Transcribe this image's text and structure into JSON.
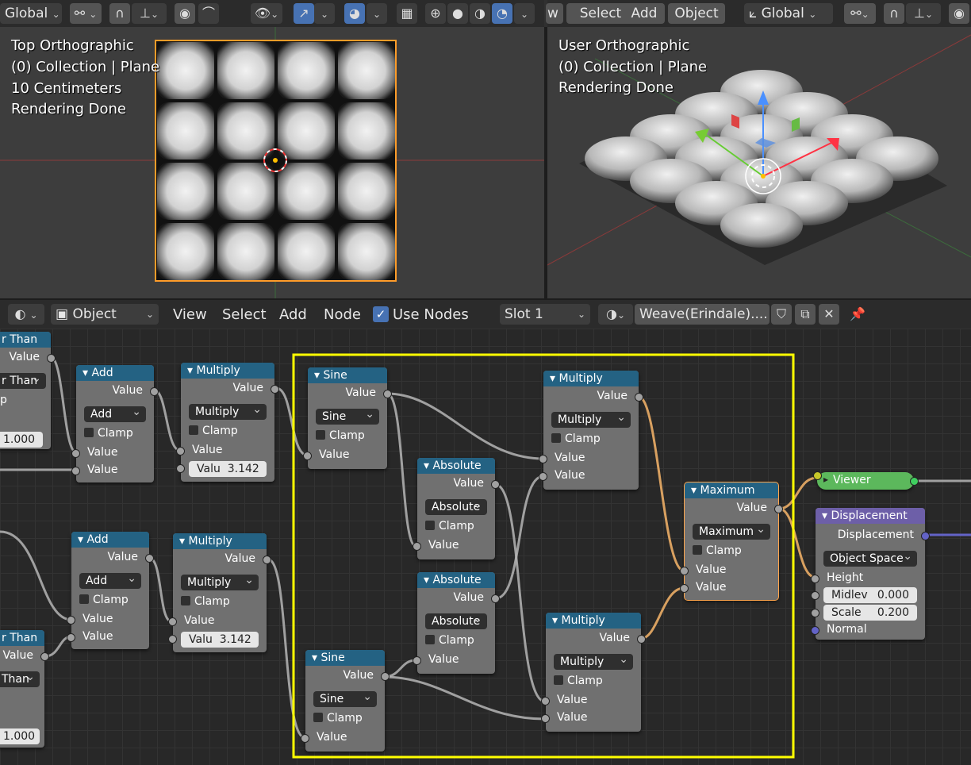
{
  "top_header": {
    "left": {
      "global_label": "Global",
      "active_mode": "Global"
    },
    "right": {
      "view_tail": "w",
      "select": "Select",
      "add": "Add",
      "object": "Object",
      "global_label": "Global"
    }
  },
  "viewport_left": {
    "line1": "Top Orthographic",
    "line2": "(0) Collection | Plane",
    "line3": "10 Centimeters",
    "line4": "Rendering Done"
  },
  "viewport_right": {
    "line1": "User Orthographic",
    "line2": "(0) Collection | Plane",
    "line3": "Rendering Done"
  },
  "node_header": {
    "mode": "Object",
    "view": "View",
    "select": "Select",
    "add": "Add",
    "node": "Node",
    "use_nodes": "Use Nodes",
    "slot": "Slot 1",
    "material": "Weave(Erindale)...."
  },
  "common": {
    "value": "Value",
    "clamp": "Clamp"
  },
  "nodes": {
    "gt1": {
      "title": "r Than",
      "value": "Value",
      "mode": "r Than",
      "p": "p",
      "field": "1.000"
    },
    "add1": {
      "title": "Add",
      "mode": "Add"
    },
    "mul1": {
      "title": "Multiply",
      "mode": "Multiply",
      "field_label": "Valu",
      "field_value": "3.142"
    },
    "add2": {
      "title": "Add",
      "mode": "Add"
    },
    "mul2": {
      "title": "Multiply",
      "mode": "Multiply",
      "field_label": "Valu",
      "field_value": "3.142"
    },
    "gt2": {
      "title": "r Than",
      "value": "Value",
      "mode": "Than",
      "field": "1.000"
    },
    "sine1": {
      "title": "Sine",
      "mode": "Sine"
    },
    "sine2": {
      "title": "Sine",
      "mode": "Sine"
    },
    "abs1": {
      "title": "Absolute",
      "mode": "Absolute"
    },
    "abs2": {
      "title": "Absolute",
      "mode": "Absolute"
    },
    "mul3": {
      "title": "Multiply",
      "mode": "Multiply"
    },
    "mul4": {
      "title": "Multiply",
      "mode": "Multiply"
    },
    "max": {
      "title": "Maximum",
      "mode": "Maximum"
    },
    "viewer": {
      "title": "Viewer"
    },
    "disp": {
      "title": "Displacement",
      "out": "Displacement",
      "space": "Object Space",
      "height": "Height",
      "midlev_label": "Midlev",
      "midlev": "0.000",
      "scale_label": "Scale",
      "scale": "0.200",
      "normal": "Normal"
    }
  },
  "colors": {
    "frame": "#ffff00",
    "selected": "#ffa64d",
    "node_header": "#246283",
    "vector_header": "#6d5fa8",
    "viewer": "#5cb85c"
  }
}
